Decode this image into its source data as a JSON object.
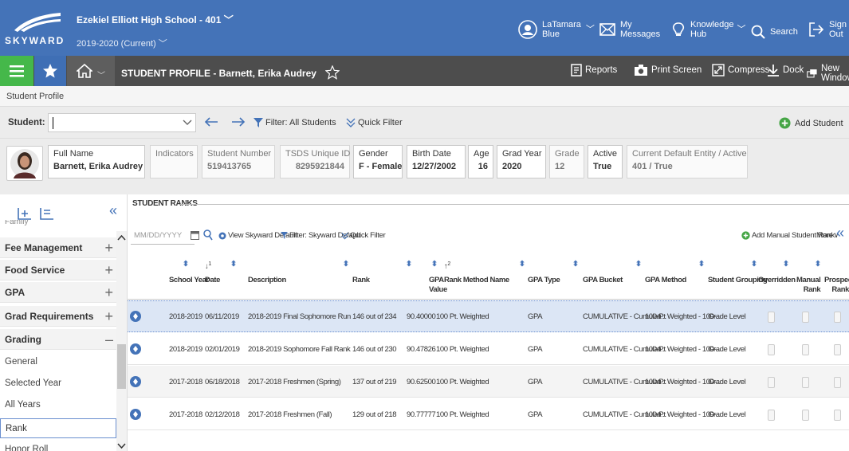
{
  "header": {
    "logo_text": "SKYWARD",
    "school": "Ezekiel Elliott High School - 401",
    "school_year": "2019-2020 (Current)",
    "user_line1": "LaTamara",
    "user_line2": "Blue",
    "messages_line1": "My",
    "messages_line2": "Messages",
    "knowledge_line1": "Knowledge",
    "knowledge_line2": "Hub",
    "search_label": "Search",
    "signout_line1": "Sign",
    "signout_line2": "Out"
  },
  "nav": {
    "title": "STUDENT PROFILE - Barnett, Erika Audrey",
    "reports": "Reports",
    "print_screen": "Print Screen",
    "compress": "Compress",
    "dock": "Dock",
    "new_window": "New Window"
  },
  "breadcrumb": "Student Profile",
  "search_row": {
    "student_label": "Student:",
    "filter_label": "Filter: All Students",
    "quick_filter": "Quick Filter",
    "add_student": "Add Student"
  },
  "student_info": {
    "full_name_label": "Full Name",
    "full_name": "Barnett, Erika Audrey",
    "indicators_label": "Indicators",
    "student_number_label": "Student Number",
    "student_number": "519413765",
    "tsds_label": "TSDS Unique ID",
    "tsds": "8295921844",
    "gender_label": "Gender",
    "gender": "F - Female",
    "birth_date_label": "Birth Date",
    "birth_date": "12/27/2002",
    "age_label": "Age",
    "age": "16",
    "grad_year_label": "Grad Year",
    "grad_year": "2020",
    "grade_label": "Grade",
    "grade": "12",
    "active_label": "Active",
    "active": "True",
    "entity_label": "Current Default Entity / Active",
    "entity": "401 / True"
  },
  "sidebar": {
    "cut_off_item": "Family",
    "items": [
      {
        "label": "Fee Management"
      },
      {
        "label": "Food Service"
      },
      {
        "label": "GPA"
      },
      {
        "label": "Grad Requirements"
      },
      {
        "label": "Grading"
      }
    ],
    "sub_items": [
      "General",
      "Selected Year",
      "All Years",
      "Rank",
      "Honor Roll"
    ],
    "selected": "Rank"
  },
  "ranks": {
    "title": "STUDENT RANKS",
    "date_placeholder": "MM/DD/YYYY",
    "view_default": "View Skyward Default",
    "filter_default": "Filter: Skyward Default",
    "quick_filter": "Quick Filter",
    "add_manual": "Add Manual Student Rank",
    "more": "More",
    "columns": {
      "school_year": "School Year",
      "date": "Date",
      "date_sort": "1",
      "description": "Description",
      "rank": "Rank",
      "gpa_value_1": "GPA",
      "gpa_value_2": "Value",
      "rank_method": "Rank Method Name",
      "rank_method_sort": "2",
      "gpa_type": "GPA Type",
      "gpa_bucket": "GPA Bucket",
      "gpa_method": "GPA Method",
      "student_grouping": "Student Grouping",
      "overridden": "Overridden",
      "manual_rank_1": "Manual",
      "manual_rank_2": "Rank",
      "prospective_1": "Prospecti",
      "prospective_2": "Rank"
    },
    "rows": [
      {
        "school_year": "2018-2019",
        "date": "06/11/2019",
        "description": "2018-2019 Final Sophomore Run",
        "rank": "146 out of 234",
        "gpa": "90.40000",
        "method": "100 Pt. Weighted",
        "gpa_type": "GPA",
        "bucket": "CUMULATIVE - Cumulati...",
        "gpa_method": "100-Pt Weighted - 100-...",
        "grouping": "Grade Level"
      },
      {
        "school_year": "2018-2019",
        "date": "02/01/2019",
        "description": "2018-2019 Sophomore Fall Rank",
        "rank": "146 out of 230",
        "gpa": "90.47826",
        "method": "100 Pt. Weighted",
        "gpa_type": "GPA",
        "bucket": "CUMULATIVE - Cumulati...",
        "gpa_method": "100-Pt Weighted - 100-...",
        "grouping": "Grade Level"
      },
      {
        "school_year": "2017-2018",
        "date": "06/18/2018",
        "description": "2017-2018 Freshmen (Spring)",
        "rank": "137 out of 219",
        "gpa": "90.62500",
        "method": "100 Pt. Weighted",
        "gpa_type": "GPA",
        "bucket": "CUMULATIVE - Cumulati...",
        "gpa_method": "100-Pt Weighted - 100-...",
        "grouping": "Grade Level"
      },
      {
        "school_year": "2017-2018",
        "date": "02/12/2018",
        "description": "2017-2018 Freshmen (Fall)",
        "rank": "129 out of 218",
        "gpa": "90.77777",
        "method": "100 Pt. Weighted",
        "gpa_type": "GPA",
        "bucket": "CUMULATIVE - Cumulati...",
        "gpa_method": "100-Pt Weighted - 100-...",
        "grouping": "Grade Level"
      }
    ]
  },
  "colors": {
    "header_blue": "#4473b8",
    "nav_green": "#45b84a",
    "nav_dark": "#4d4d4d",
    "selected_row": "#dce6f5"
  }
}
